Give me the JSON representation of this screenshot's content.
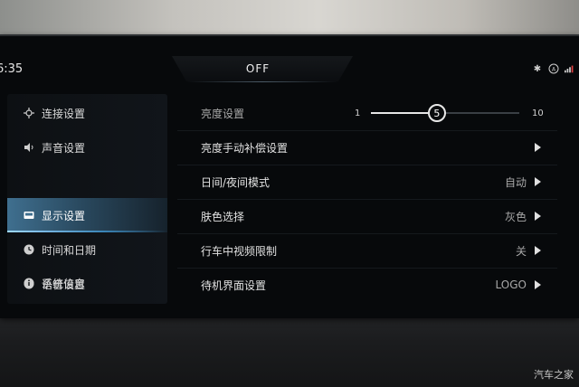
{
  "statusbar": {
    "time": "6:35",
    "ac_status": "OFF",
    "status_icons": [
      {
        "icon": "bluetooth-icon",
        "glyph": "✱"
      },
      {
        "icon": "auto-climate-icon",
        "glyph": "A"
      },
      {
        "icon": "signal-icon",
        "glyph": "▮"
      }
    ]
  },
  "sidebar": {
    "items": [
      {
        "label": "连接设置",
        "icon": "connection-icon",
        "active": false
      },
      {
        "label": "声音设置",
        "icon": "speaker-icon",
        "active": false
      },
      {
        "label": "显示设置",
        "icon": "display-icon",
        "active": true
      },
      {
        "label": "时间和日期",
        "icon": "clock-icon",
        "active": false
      },
      {
        "label": "语音设置",
        "icon": "voice-icon",
        "active": false
      },
      {
        "label": "系统信息",
        "icon": "info-icon",
        "active": false
      }
    ]
  },
  "settings": {
    "brightness": {
      "label": "亮度设置",
      "min": "1",
      "max": "10",
      "value": "5",
      "value_fraction": 0.444
    },
    "rows": [
      {
        "label": "亮度手动补偿设置",
        "value": ""
      },
      {
        "label": "日间/夜间模式",
        "value": "自动"
      },
      {
        "label": "肤色选择",
        "value": "灰色"
      },
      {
        "label": "行车中视频限制",
        "value": "关"
      },
      {
        "label": "待机界面设置",
        "value": "LOGO"
      }
    ]
  },
  "watermark": "汽车之家",
  "colors": {
    "accent": "#3f6f8f",
    "background": "#07090b"
  }
}
